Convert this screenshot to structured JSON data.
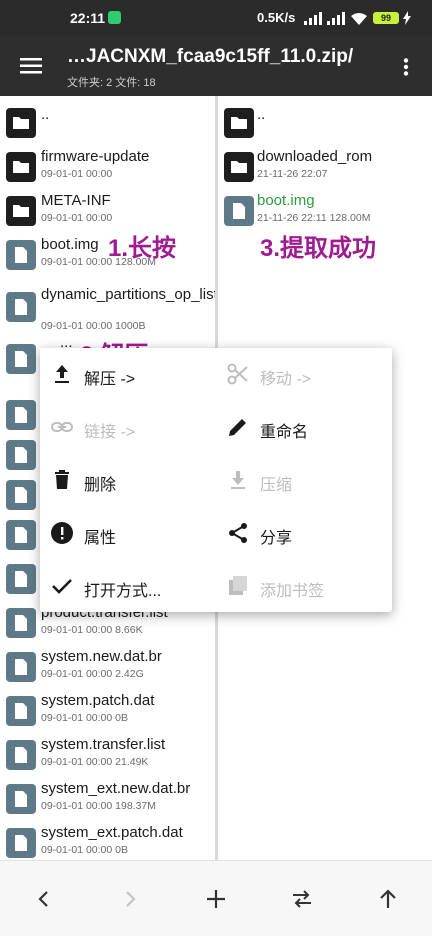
{
  "status_bar": {
    "time": "22:11",
    "speed": "0.5K/s",
    "battery": "99"
  },
  "app_bar": {
    "title": "…JACNXM_fcaa9c15ff_11.0.zip/",
    "subtitle": "文件夹: 2  文件: 18"
  },
  "left_pane": {
    "items": [
      {
        "name": "..",
        "meta": "",
        "kind": "folder"
      },
      {
        "name": "firmware-update",
        "meta": "09-01-01 00:00",
        "kind": "folder"
      },
      {
        "name": "META-INF",
        "meta": "09-01-01 00:00",
        "kind": "folder"
      },
      {
        "name": "boot.img",
        "meta": "09-01-01 00:00  128.00M",
        "kind": "file"
      },
      {
        "name": "dynamic_partitions_op_list",
        "meta": "09-01-01 00:00  1000B",
        "kind": "file"
      },
      {
        "name": "...",
        "meta": "",
        "kind": "file"
      },
      {
        "name": "product.transfer.list",
        "meta": "09-01-01 00:00  8.66K",
        "kind": "file"
      },
      {
        "name": "system.new.dat.br",
        "meta": "09-01-01 00:00  2.42G",
        "kind": "file"
      },
      {
        "name": "system.patch.dat",
        "meta": "09-01-01 00:00  0B",
        "kind": "file"
      },
      {
        "name": "system.transfer.list",
        "meta": "09-01-01 00:00  21.49K",
        "kind": "file"
      },
      {
        "name": "system_ext.new.dat.br",
        "meta": "09-01-01 00:00  198.37M",
        "kind": "file"
      },
      {
        "name": "system_ext.patch.dat",
        "meta": "09-01-01 00:00  0B",
        "kind": "file"
      }
    ]
  },
  "right_pane": {
    "items": [
      {
        "name": "..",
        "meta": "",
        "kind": "folder"
      },
      {
        "name": "downloaded_rom",
        "meta": "21-11-26 22:07",
        "kind": "folder"
      },
      {
        "name": "boot.img",
        "meta": "21-11-26 22:11  128.00M",
        "kind": "file"
      }
    ]
  },
  "annotations": {
    "step1": "1.长按",
    "step2": "2.解压",
    "step3": "3.提取成功"
  },
  "context_menu": {
    "extract": "解压 ->",
    "move": "移动 ->",
    "link": "链接 ->",
    "rename": "重命名",
    "delete": "删除",
    "compress": "压缩",
    "properties": "属性",
    "share": "分享",
    "open_with": "打开方式...",
    "add_bookmark": "添加书签"
  },
  "colors": {
    "accent_annotation": "#a01a91",
    "new_file_green": "#2e9b3f",
    "appbar": "#2e2e2e"
  }
}
